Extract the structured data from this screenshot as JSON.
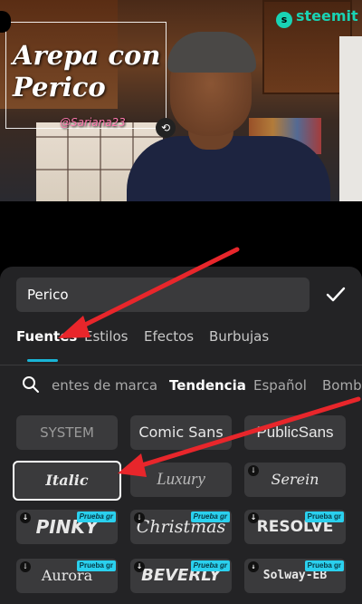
{
  "preview": {
    "title_line1": "Arepa con",
    "title_line2": "Perico",
    "watermark": "@Sariana23",
    "logo": "steemit",
    "rotate_icon": "rotate-icon"
  },
  "editor": {
    "text_value": "Perico",
    "confirm_icon": "check-icon"
  },
  "tabs": [
    "Fuentes",
    "Estilos",
    "Efectos",
    "Burbujas"
  ],
  "categories": [
    "entes de marca",
    "Tendencia",
    "Español",
    "Bomb"
  ],
  "fonts": {
    "row1": [
      "SYSTEM",
      "Comic Sans",
      "PublicSans"
    ],
    "row2": [
      "Italic",
      "Luxury",
      "Serein"
    ],
    "row3": [
      "PINKY",
      "Christmas",
      "RESOLVE"
    ],
    "row4": [
      "Aurora",
      "BEVERLY",
      "Solway-EB"
    ]
  },
  "badge": "Prueba gr",
  "colors": {
    "accent": "#19b4d6",
    "badge": "#2ad0ee",
    "arrow": "#e8262b",
    "logo": "#19d3b4"
  }
}
